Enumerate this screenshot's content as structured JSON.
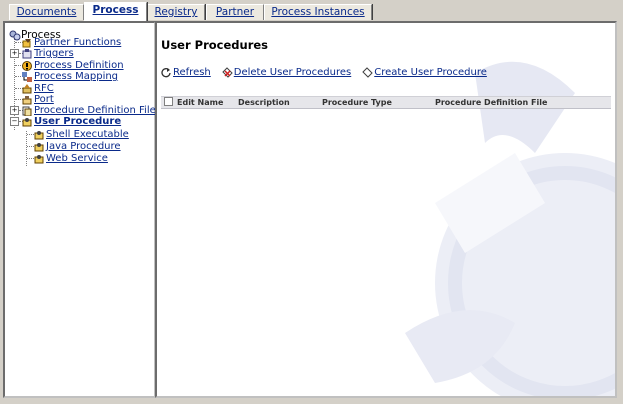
{
  "tabs": [
    "Documents",
    "Process",
    "Registry",
    "Partner",
    "Process Instances"
  ],
  "active_tab": "Process",
  "tree": {
    "root": "Process",
    "items": [
      {
        "label": "Partner Functions",
        "icon": "partner-functions-icon"
      },
      {
        "label": "Triggers",
        "icon": "triggers-icon"
      },
      {
        "label": "Process Definition",
        "icon": "process-definition-icon"
      },
      {
        "label": "Process Mapping",
        "icon": "process-mapping-icon"
      },
      {
        "label": "RFC",
        "icon": "rfc-icon"
      },
      {
        "label": "Port",
        "icon": "port-icon"
      },
      {
        "label": "Procedure Definition Files",
        "icon": "procedure-files-icon"
      },
      {
        "label": "User Procedure",
        "icon": "user-procedure-icon"
      }
    ],
    "children": [
      {
        "label": "Shell Executable",
        "icon": "shell-executable-icon"
      },
      {
        "label": "Java Procedure",
        "icon": "java-procedure-icon"
      },
      {
        "label": "Web Service",
        "icon": "web-service-icon"
      }
    ]
  },
  "main": {
    "title": "User Procedures",
    "actions": {
      "refresh": "Refresh",
      "delete": "Delete User Procedures",
      "create": "Create User Procedure"
    },
    "columns": {
      "edit_name": "Edit Name",
      "description": "Description",
      "procedure_type": "Procedure Type",
      "definition_file": "Procedure Definition File"
    }
  },
  "colors": {
    "link": "#0a2a8a",
    "chrome": "#d4d0c8",
    "watermark": "#e4e6f2"
  }
}
